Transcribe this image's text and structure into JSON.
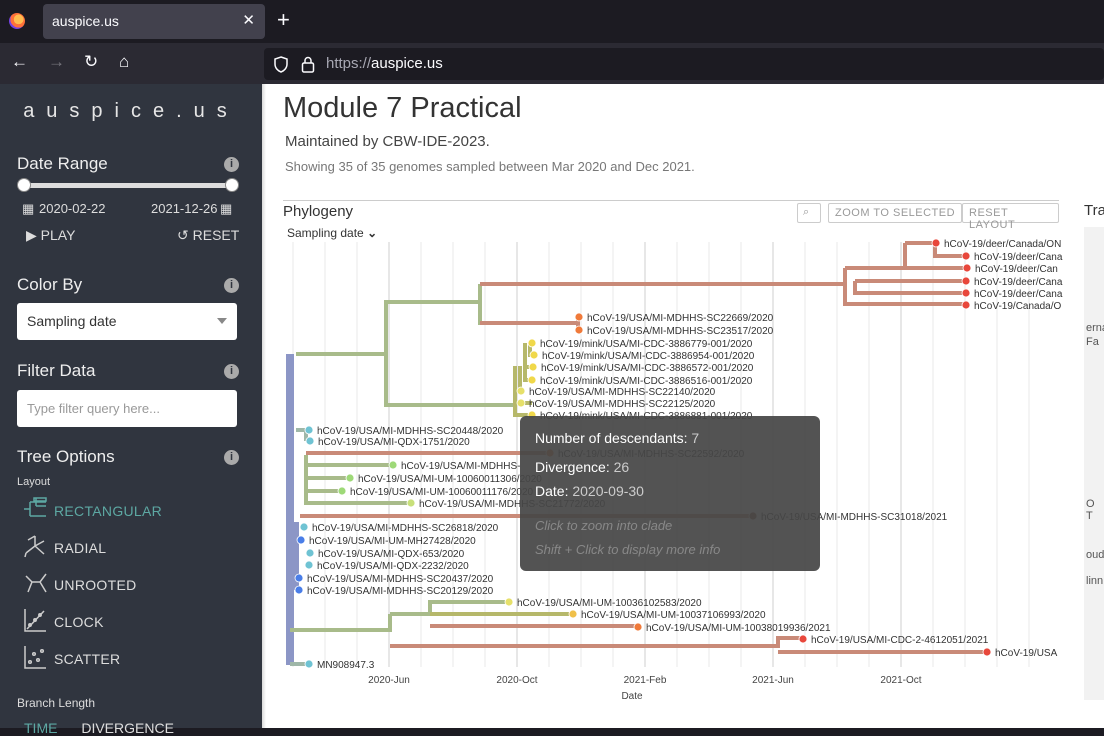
{
  "browser": {
    "tab_title": "auspice.us",
    "url_scheme": "https://",
    "url_host": "auspice.us"
  },
  "sidebar": {
    "title": "auspice.us",
    "date_range": {
      "heading": "Date Range",
      "start": "2020-02-22",
      "end": "2021-12-26",
      "play": "PLAY",
      "reset": "RESET"
    },
    "color_by": {
      "heading": "Color By",
      "value": "Sampling date"
    },
    "filter": {
      "heading": "Filter Data",
      "placeholder": "Type filter query here..."
    },
    "tree_options": {
      "heading": "Tree Options",
      "layout_label": "Layout",
      "layouts": [
        "RECTANGULAR",
        "RADIAL",
        "UNROOTED",
        "CLOCK",
        "SCATTER"
      ],
      "selected_layout": "RECTANGULAR",
      "branch_length_label": "Branch Length",
      "branch_length_options": [
        "TIME",
        "DIVERGENCE"
      ]
    }
  },
  "main": {
    "title": "Module 7 Practical",
    "maintainer": "Maintained by CBW-IDE-2023.",
    "summary": "Showing 35 of 35 genomes sampled between Mar 2020 and Dec 2021.",
    "phylogeny": {
      "title": "Phylogeny",
      "color_dropdown": "Sampling date",
      "zoom_selected": "ZOOM TO SELECTED",
      "reset_layout": "RESET LAYOUT",
      "x_ticks": [
        "2020-Jun",
        "2020-Oct",
        "2021-Feb",
        "2021-Jun",
        "2021-Oct"
      ],
      "x_axis_label": "Date"
    },
    "map_title_fragment": "Tra",
    "map_fragments": [
      "erna",
      "Fa",
      "O T",
      "oud",
      "linn"
    ]
  },
  "tooltip": {
    "descendants_label": "Number of descendants:",
    "descendants_value": "7",
    "divergence_label": "Divergence:",
    "divergence_value": "26",
    "date_label": "Date:",
    "date_value": "2020-09-30",
    "hint1": "Click to zoom into clade",
    "hint2": "Shift + Click to display more info"
  },
  "tips": [
    "hCoV-19/deer/Canada/ON",
    "hCoV-19/deer/Cana",
    "hCoV-19/deer/Can",
    "hCoV-19/deer/Cana",
    "hCoV-19/deer/Cana",
    "hCoV-19/Canada/O",
    "hCoV-19/USA/MI-MDHHS-SC22669/2020",
    "hCoV-19/USA/MI-MDHHS-SC23517/2020",
    "hCoV-19/mink/USA/MI-CDC-3886779-001/2020",
    "hCoV-19/mink/USA/MI-CDC-3886954-001/2020",
    "hCoV-19/mink/USA/MI-CDC-3886572-001/2020",
    "hCoV-19/mink/USA/MI-CDC-3886516-001/2020",
    "hCoV-19/USA/MI-MDHHS-SC22140/2020",
    "hCoV-19/USA/MI-MDHHS-SC22125/2020",
    "hCoV-19/mink/USA/MI-CDC-3886881-001/2020",
    "hCoV-19/USA/MI-MDHHS-SC20448/2020",
    "hCoV-19/USA/MI-QDX-1751/2020",
    "hCoV-19/USA/MI-MDHHS-SC22592/2020",
    "hCoV-19/USA/MI-MDHHS-",
    "hCoV-19/USA/MI-UM-10060011306/2020",
    "hCoV-19/USA/MI-UM-10060011176/2020",
    "hCoV-19/USA/MI-MDHHS-SC21772/2020",
    "hCoV-19/USA/MI-MDHHS-SC31018/2021",
    "hCoV-19/USA/MI-MDHHS-SC26818/2020",
    "hCoV-19/USA/MI-UM-MH27428/2020",
    "hCoV-19/USA/MI-QDX-653/2020",
    "hCoV-19/USA/MI-QDX-2232/2020",
    "hCoV-19/USA/MI-MDHHS-SC20437/2020",
    "hCoV-19/USA/MI-MDHHS-SC20129/2020",
    "hCoV-19/USA/MI-UM-10036102583/2020",
    "hCoV-19/USA/MI-UM-10037106993/2020",
    "hCoV-19/USA/MI-UM-10038019936/2021",
    "hCoV-19/USA/MI-CDC-2-4612051/2021",
    "hCoV-19/USA",
    "MN908947.3"
  ]
}
